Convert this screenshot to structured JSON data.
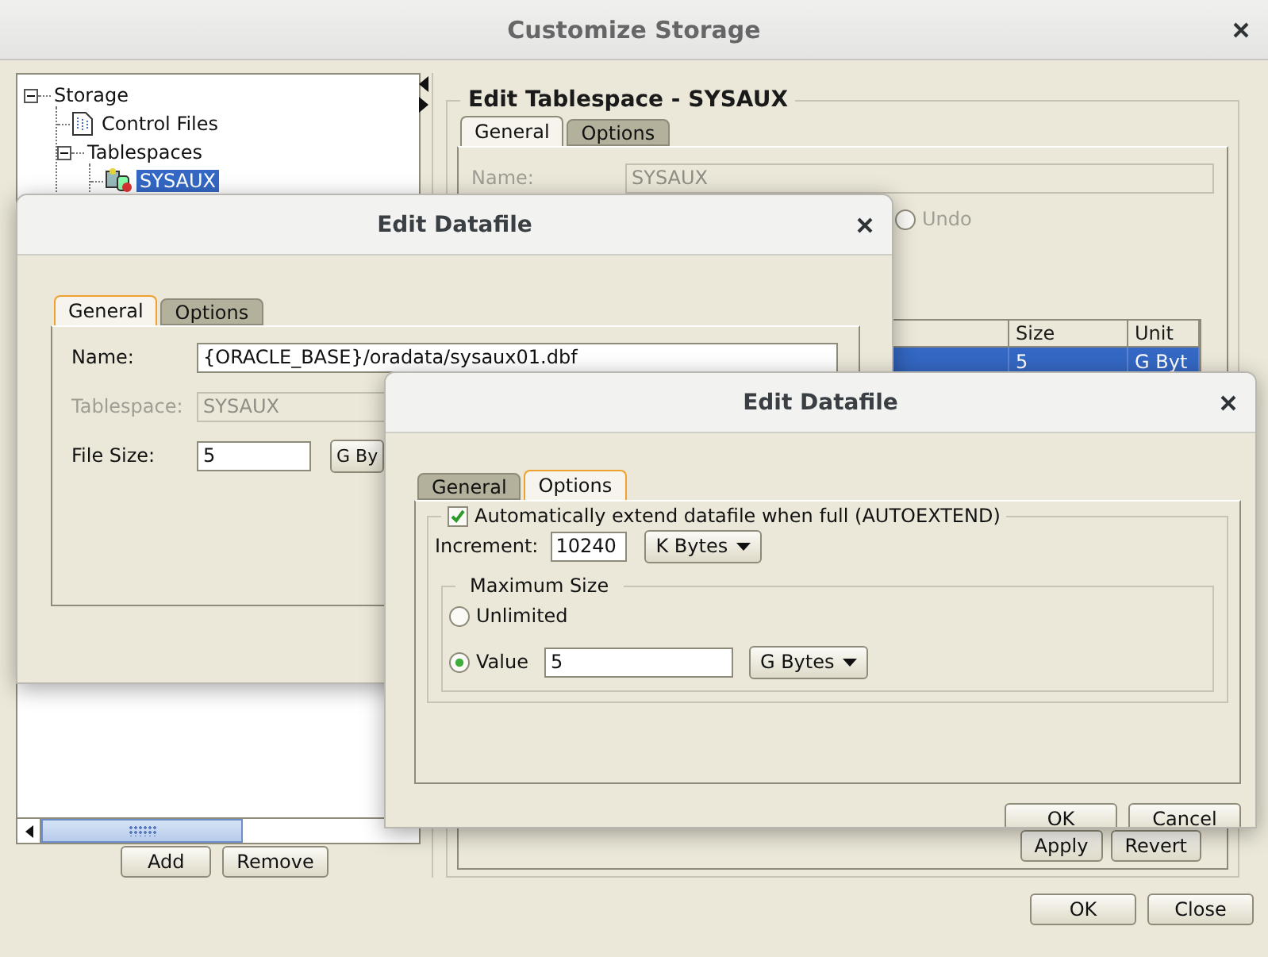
{
  "window": {
    "title": "Customize Storage"
  },
  "tree": [
    {
      "label": "Storage",
      "expanded": true,
      "selected": false,
      "children": [
        {
          "label": "Control Files",
          "kind": "file",
          "selected": false
        },
        {
          "label": "Tablespaces",
          "expanded": true,
          "selected": false,
          "children": [
            {
              "label": "SYSAUX",
              "kind": "tablespace",
              "selected": true
            }
          ]
        }
      ]
    }
  ],
  "tree_buttons": [
    "Add",
    "Remove"
  ],
  "tablespace_panel": {
    "title": "Edit Tablespace - SYSAUX",
    "tabs": [
      {
        "label": "General",
        "selected": true,
        "focused": false
      },
      {
        "label": "Options",
        "selected": false,
        "focused": false
      }
    ],
    "name_label": "Name:",
    "name_value": "SYSAUX",
    "undo": {
      "label": "Undo",
      "selected": false
    },
    "table": {
      "columns": [
        "Size",
        "Unit"
      ],
      "rows": [
        {
          "selected": true,
          "cells": [
            "5",
            "G Byt"
          ]
        }
      ]
    },
    "buttons": [
      "Apply",
      "Revert"
    ]
  },
  "buttons": [
    "OK",
    "Close"
  ],
  "datafile_dialog": {
    "title": "Edit Datafile",
    "tabs": [
      {
        "label": "General",
        "selected": true,
        "focused": true
      },
      {
        "label": "Options",
        "selected": false,
        "focused": false
      }
    ],
    "fields": [
      {
        "kind": "text",
        "label": "Name:",
        "value": "{ORACLE_BASE}/oradata/sysaux01.dbf",
        "disabled": false
      },
      {
        "kind": "text",
        "label": "Tablespace:",
        "value": "SYSAUX",
        "disabled": true
      },
      {
        "kind": "size",
        "label": "File Size:",
        "value": "5",
        "unit": "G By",
        "disabled": false
      }
    ]
  },
  "options_dialog": {
    "title": "Edit Datafile",
    "tabs": [
      {
        "label": "General",
        "selected": false,
        "focused": false
      },
      {
        "label": "Options",
        "selected": true,
        "focused": true
      }
    ],
    "autoextend": {
      "label": "Automatically extend datafile when full (AUTOEXTEND)",
      "checked": true
    },
    "increment": {
      "label": "Increment:",
      "value": "10240",
      "unit": "K Bytes"
    },
    "max_size": {
      "title": "Maximum Size",
      "options": [
        {
          "kind": "plain",
          "label": "Unlimited",
          "selected": false
        },
        {
          "kind": "value",
          "label": "Value",
          "selected": true,
          "value": "5",
          "unit": "G Bytes"
        }
      ]
    },
    "buttons": [
      "OK",
      "Cancel"
    ]
  }
}
